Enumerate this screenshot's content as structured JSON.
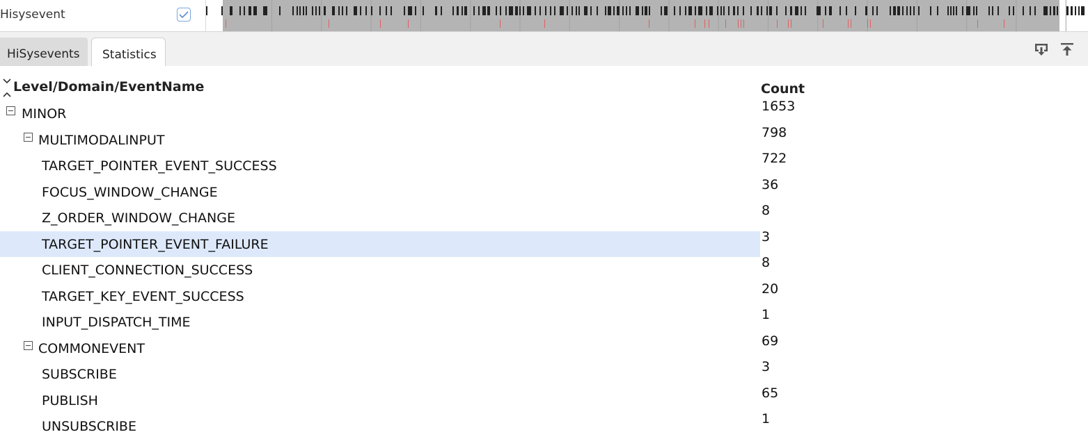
{
  "track": {
    "name": "Hisysevent",
    "checked": true
  },
  "tabs": [
    {
      "label": "HiSysevents",
      "active": false
    },
    {
      "label": "Statistics",
      "active": true
    }
  ],
  "toolbar": {
    "export_icon": "download-tray-icon",
    "top_icon": "scroll-to-top-icon"
  },
  "table": {
    "columns": {
      "name": "Level/Domain/EventName",
      "count": "Count"
    },
    "sort_icon": "sort-up-down-icon",
    "rows": [
      {
        "name": "MINOR",
        "count": "1653",
        "depth": 0,
        "expandable": true,
        "selected": false
      },
      {
        "name": "MULTIMODALINPUT",
        "count": "798",
        "depth": 1,
        "expandable": true,
        "selected": false
      },
      {
        "name": "TARGET_POINTER_EVENT_SUCCESS",
        "count": "722",
        "depth": 2,
        "expandable": false,
        "selected": false
      },
      {
        "name": "FOCUS_WINDOW_CHANGE",
        "count": "36",
        "depth": 2,
        "expandable": false,
        "selected": false
      },
      {
        "name": "Z_ORDER_WINDOW_CHANGE",
        "count": "8",
        "depth": 2,
        "expandable": false,
        "selected": false
      },
      {
        "name": "TARGET_POINTER_EVENT_FAILURE",
        "count": "3",
        "depth": 2,
        "expandable": false,
        "selected": true
      },
      {
        "name": "CLIENT_CONNECTION_SUCCESS",
        "count": "8",
        "depth": 2,
        "expandable": false,
        "selected": false
      },
      {
        "name": "TARGET_KEY_EVENT_SUCCESS",
        "count": "20",
        "depth": 2,
        "expandable": false,
        "selected": false
      },
      {
        "name": "INPUT_DISPATCH_TIME",
        "count": "1",
        "depth": 2,
        "expandable": false,
        "selected": false
      },
      {
        "name": "COMMONEVENT",
        "count": "69",
        "depth": 1,
        "expandable": true,
        "selected": false
      },
      {
        "name": "SUBSCRIBE",
        "count": "3",
        "depth": 2,
        "expandable": false,
        "selected": false
      },
      {
        "name": "PUBLISH",
        "count": "65",
        "depth": 2,
        "expandable": false,
        "selected": false
      },
      {
        "name": "UNSUBSCRIBE",
        "count": "1",
        "depth": 2,
        "expandable": false,
        "selected": false
      }
    ]
  },
  "colors": {
    "selected_row": "#dde9fb",
    "timeline_selection": "#b4b4b4",
    "event_mark": "#222222",
    "failure_mark": "#e06060",
    "checkbox_accent": "#5b8fd6"
  }
}
